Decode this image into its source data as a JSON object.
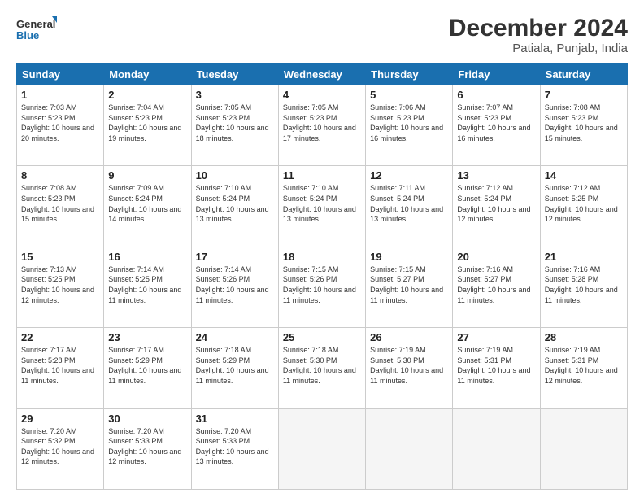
{
  "logo": {
    "general": "General",
    "blue": "Blue"
  },
  "title": "December 2024",
  "subtitle": "Patiala, Punjab, India",
  "days_of_week": [
    "Sunday",
    "Monday",
    "Tuesday",
    "Wednesday",
    "Thursday",
    "Friday",
    "Saturday"
  ],
  "weeks": [
    [
      {
        "day": "1",
        "sunrise": "7:03 AM",
        "sunset": "5:23 PM",
        "daylight": "10 hours and 20 minutes."
      },
      {
        "day": "2",
        "sunrise": "7:04 AM",
        "sunset": "5:23 PM",
        "daylight": "10 hours and 19 minutes."
      },
      {
        "day": "3",
        "sunrise": "7:05 AM",
        "sunset": "5:23 PM",
        "daylight": "10 hours and 18 minutes."
      },
      {
        "day": "4",
        "sunrise": "7:05 AM",
        "sunset": "5:23 PM",
        "daylight": "10 hours and 17 minutes."
      },
      {
        "day": "5",
        "sunrise": "7:06 AM",
        "sunset": "5:23 PM",
        "daylight": "10 hours and 16 minutes."
      },
      {
        "day": "6",
        "sunrise": "7:07 AM",
        "sunset": "5:23 PM",
        "daylight": "10 hours and 16 minutes."
      },
      {
        "day": "7",
        "sunrise": "7:08 AM",
        "sunset": "5:23 PM",
        "daylight": "10 hours and 15 minutes."
      }
    ],
    [
      {
        "day": "8",
        "sunrise": "7:08 AM",
        "sunset": "5:23 PM",
        "daylight": "10 hours and 15 minutes."
      },
      {
        "day": "9",
        "sunrise": "7:09 AM",
        "sunset": "5:24 PM",
        "daylight": "10 hours and 14 minutes."
      },
      {
        "day": "10",
        "sunrise": "7:10 AM",
        "sunset": "5:24 PM",
        "daylight": "10 hours and 13 minutes."
      },
      {
        "day": "11",
        "sunrise": "7:10 AM",
        "sunset": "5:24 PM",
        "daylight": "10 hours and 13 minutes."
      },
      {
        "day": "12",
        "sunrise": "7:11 AM",
        "sunset": "5:24 PM",
        "daylight": "10 hours and 13 minutes."
      },
      {
        "day": "13",
        "sunrise": "7:12 AM",
        "sunset": "5:24 PM",
        "daylight": "10 hours and 12 minutes."
      },
      {
        "day": "14",
        "sunrise": "7:12 AM",
        "sunset": "5:25 PM",
        "daylight": "10 hours and 12 minutes."
      }
    ],
    [
      {
        "day": "15",
        "sunrise": "7:13 AM",
        "sunset": "5:25 PM",
        "daylight": "10 hours and 12 minutes."
      },
      {
        "day": "16",
        "sunrise": "7:14 AM",
        "sunset": "5:25 PM",
        "daylight": "10 hours and 11 minutes."
      },
      {
        "day": "17",
        "sunrise": "7:14 AM",
        "sunset": "5:26 PM",
        "daylight": "10 hours and 11 minutes."
      },
      {
        "day": "18",
        "sunrise": "7:15 AM",
        "sunset": "5:26 PM",
        "daylight": "10 hours and 11 minutes."
      },
      {
        "day": "19",
        "sunrise": "7:15 AM",
        "sunset": "5:27 PM",
        "daylight": "10 hours and 11 minutes."
      },
      {
        "day": "20",
        "sunrise": "7:16 AM",
        "sunset": "5:27 PM",
        "daylight": "10 hours and 11 minutes."
      },
      {
        "day": "21",
        "sunrise": "7:16 AM",
        "sunset": "5:28 PM",
        "daylight": "10 hours and 11 minutes."
      }
    ],
    [
      {
        "day": "22",
        "sunrise": "7:17 AM",
        "sunset": "5:28 PM",
        "daylight": "10 hours and 11 minutes."
      },
      {
        "day": "23",
        "sunrise": "7:17 AM",
        "sunset": "5:29 PM",
        "daylight": "10 hours and 11 minutes."
      },
      {
        "day": "24",
        "sunrise": "7:18 AM",
        "sunset": "5:29 PM",
        "daylight": "10 hours and 11 minutes."
      },
      {
        "day": "25",
        "sunrise": "7:18 AM",
        "sunset": "5:30 PM",
        "daylight": "10 hours and 11 minutes."
      },
      {
        "day": "26",
        "sunrise": "7:19 AM",
        "sunset": "5:30 PM",
        "daylight": "10 hours and 11 minutes."
      },
      {
        "day": "27",
        "sunrise": "7:19 AM",
        "sunset": "5:31 PM",
        "daylight": "10 hours and 11 minutes."
      },
      {
        "day": "28",
        "sunrise": "7:19 AM",
        "sunset": "5:31 PM",
        "daylight": "10 hours and 12 minutes."
      }
    ],
    [
      {
        "day": "29",
        "sunrise": "7:20 AM",
        "sunset": "5:32 PM",
        "daylight": "10 hours and 12 minutes."
      },
      {
        "day": "30",
        "sunrise": "7:20 AM",
        "sunset": "5:33 PM",
        "daylight": "10 hours and 12 minutes."
      },
      {
        "day": "31",
        "sunrise": "7:20 AM",
        "sunset": "5:33 PM",
        "daylight": "10 hours and 13 minutes."
      },
      null,
      null,
      null,
      null
    ]
  ]
}
